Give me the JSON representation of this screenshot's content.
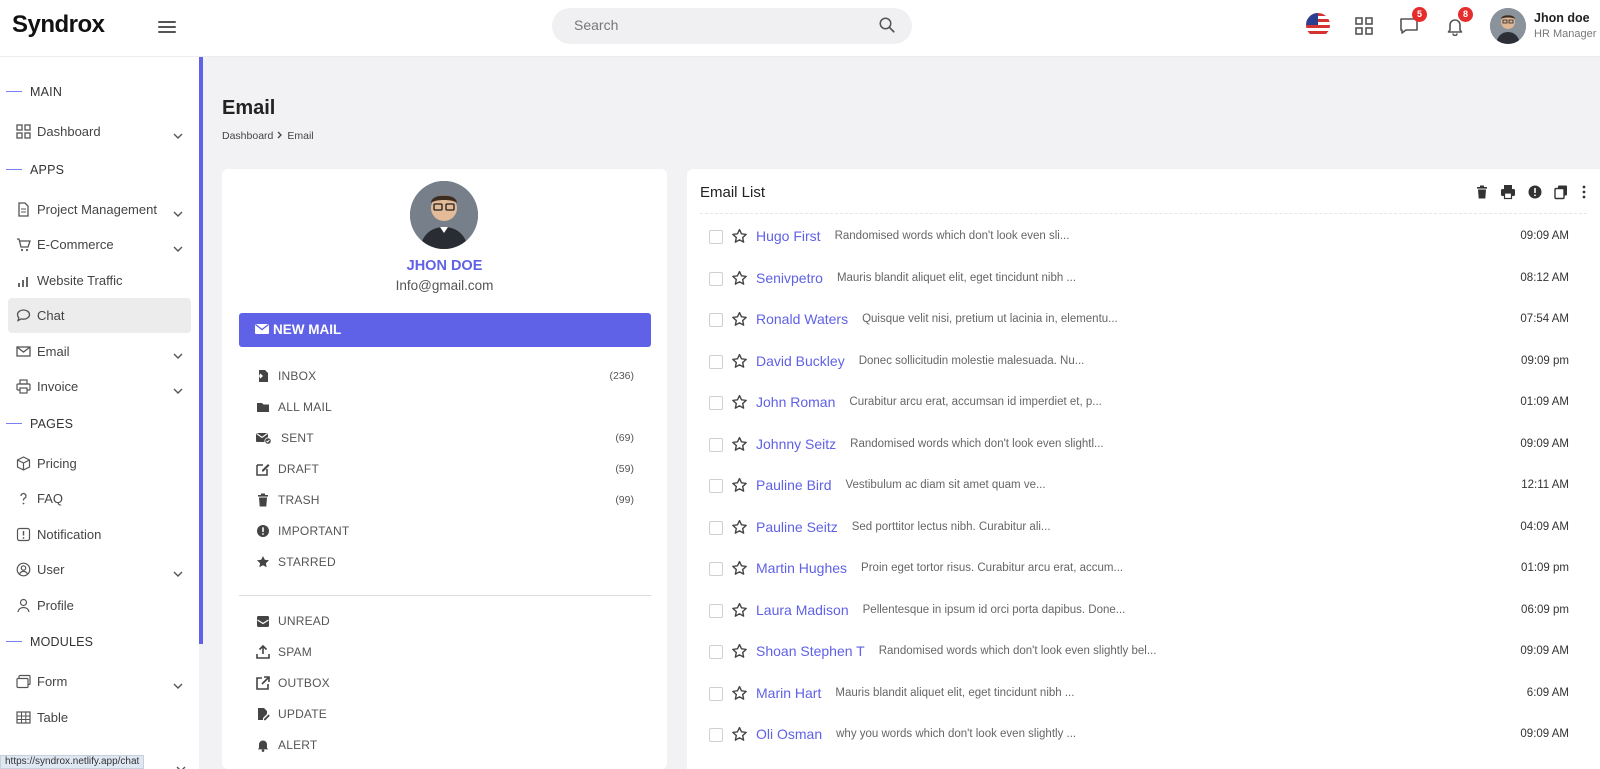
{
  "header": {
    "logo": "Syndrox",
    "search_placeholder": "Search",
    "messages_badge": "5",
    "notifications_badge": "8",
    "user_name": "Jhon doe",
    "user_role": "HR Manager"
  },
  "sidebar": {
    "sections": [
      "MAIN",
      "APPS",
      "PAGES",
      "MODULES"
    ],
    "items": [
      {
        "label": "Dashboard"
      },
      {
        "label": "Project Management"
      },
      {
        "label": "E-Commerce"
      },
      {
        "label": "Website Traffic"
      },
      {
        "label": "Chat"
      },
      {
        "label": "Email"
      },
      {
        "label": "Invoice"
      },
      {
        "label": "Pricing"
      },
      {
        "label": "FAQ"
      },
      {
        "label": "Notification"
      },
      {
        "label": "User"
      },
      {
        "label": "Profile"
      },
      {
        "label": "Form"
      },
      {
        "label": "Table"
      }
    ],
    "status_url": "https://syndrox.netlify.app/chat"
  },
  "page": {
    "title": "Email",
    "breadcrumb": [
      "Dashboard",
      "Email"
    ]
  },
  "mailbox": {
    "name": "JHON DOE",
    "email": "Info@gmail.com",
    "new_mail_label": "NEW MAIL",
    "folders": [
      {
        "label": "INBOX",
        "count": "(236)"
      },
      {
        "label": "ALL MAIL",
        "count": ""
      },
      {
        "label": "SENT",
        "count": "(69)"
      },
      {
        "label": "DRAFT",
        "count": "(59)"
      },
      {
        "label": "TRASH",
        "count": "(99)"
      },
      {
        "label": "IMPORTANT",
        "count": ""
      },
      {
        "label": "STARRED",
        "count": ""
      }
    ],
    "labels": [
      {
        "label": "UNREAD"
      },
      {
        "label": "SPAM"
      },
      {
        "label": "OUTBOX"
      },
      {
        "label": "UPDATE"
      },
      {
        "label": "ALERT"
      }
    ]
  },
  "email_list": {
    "title": "Email List",
    "rows": [
      {
        "sender": "Hugo First",
        "snippet": "Randomised words which don't look even sli...",
        "time": "09:09 AM"
      },
      {
        "sender": "Senivpetro",
        "snippet": "Mauris blandit aliquet elit, eget tincidunt nibh ...",
        "time": "08:12 AM"
      },
      {
        "sender": "Ronald Waters",
        "snippet": "Quisque velit nisi, pretium ut lacinia in, elementu...",
        "time": "07:54 AM"
      },
      {
        "sender": "David Buckley",
        "snippet": "Donec sollicitudin molestie malesuada. Nu...",
        "time": "09:09 pm"
      },
      {
        "sender": "John Roman",
        "snippet": "Curabitur arcu erat, accumsan id imperdiet et, p...",
        "time": "01:09 AM"
      },
      {
        "sender": "Johnny Seitz",
        "snippet": "Randomised words which don't look even slightl...",
        "time": "09:09 AM"
      },
      {
        "sender": "Pauline Bird",
        "snippet": "Vestibulum ac diam sit amet quam ve...",
        "time": "12:11 AM"
      },
      {
        "sender": "Pauline Seitz",
        "snippet": "Sed porttitor lectus nibh. Curabitur ali...",
        "time": "04:09 AM"
      },
      {
        "sender": "Martin Hughes",
        "snippet": "Proin eget tortor risus. Curabitur arcu erat, accum...",
        "time": "01:09 pm"
      },
      {
        "sender": "Laura Madison",
        "snippet": "Pellentesque in ipsum id orci porta dapibus. Done...",
        "time": "06:09 pm"
      },
      {
        "sender": "Shoan Stephen T",
        "snippet": "Randomised words which don't look even slightly bel...",
        "time": "09:09 AM"
      },
      {
        "sender": "Marin Hart",
        "snippet": "Mauris blandit aliquet elit, eget tincidunt nibh ...",
        "time": "6:09 AM"
      },
      {
        "sender": "Oli Osman",
        "snippet": "why you words which don't look even slightly ...",
        "time": "09:09 AM"
      }
    ]
  },
  "colors": {
    "accent": "#5f61e6",
    "badge": "#e52d2d"
  }
}
